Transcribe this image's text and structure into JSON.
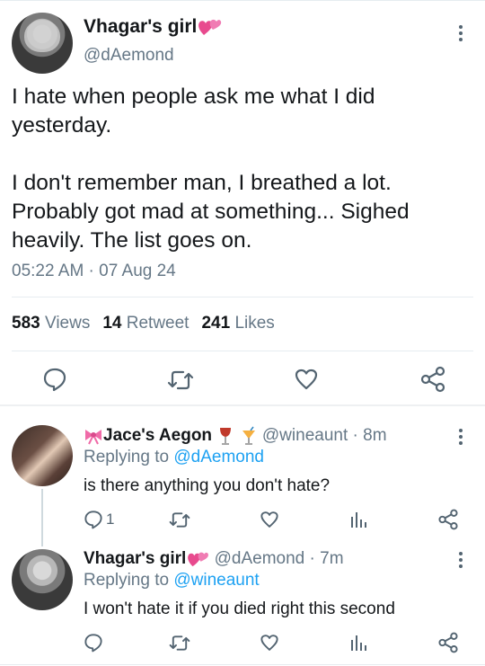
{
  "tweet": {
    "author_name": "Vhagar's girl",
    "author_handle": "@dAemond",
    "text": "I hate when people ask me what I did yesterday.\n\nI don't remember man, I breathed a lot. Probably got mad at something... Sighed heavily. The list goes on.",
    "timestamp": "05:22 AM · 07 Aug 24",
    "stats": {
      "views_count": "583",
      "views_label": "Views",
      "retweet_count": "14",
      "retweet_label": "Retweet",
      "likes_count": "241",
      "likes_label": "Likes"
    }
  },
  "replies": [
    {
      "author_name": "Jace's Aegon",
      "emojis": [
        "ribbon-emoji",
        "wine-glass-emoji",
        "tropical-drink-emoji"
      ],
      "author_handle": "@wineaunt",
      "age": "· 8m",
      "replying_label": "Replying to",
      "replying_to": "@dAemond",
      "text": "is there anything you don't hate?",
      "reply_count": "1"
    },
    {
      "author_name": "Vhagar's girl",
      "emojis": [
        "heart-emoji"
      ],
      "author_handle": "@dAemond",
      "age": "· 7m",
      "replying_label": "Replying to",
      "replying_to": "@wineaunt",
      "text": "I won't hate it if you died right this second",
      "reply_count": ""
    }
  ],
  "colors": {
    "link": "#1da1f2",
    "muted": "#657786",
    "text": "#14171a",
    "heart_emoji": "#e84a8e"
  }
}
